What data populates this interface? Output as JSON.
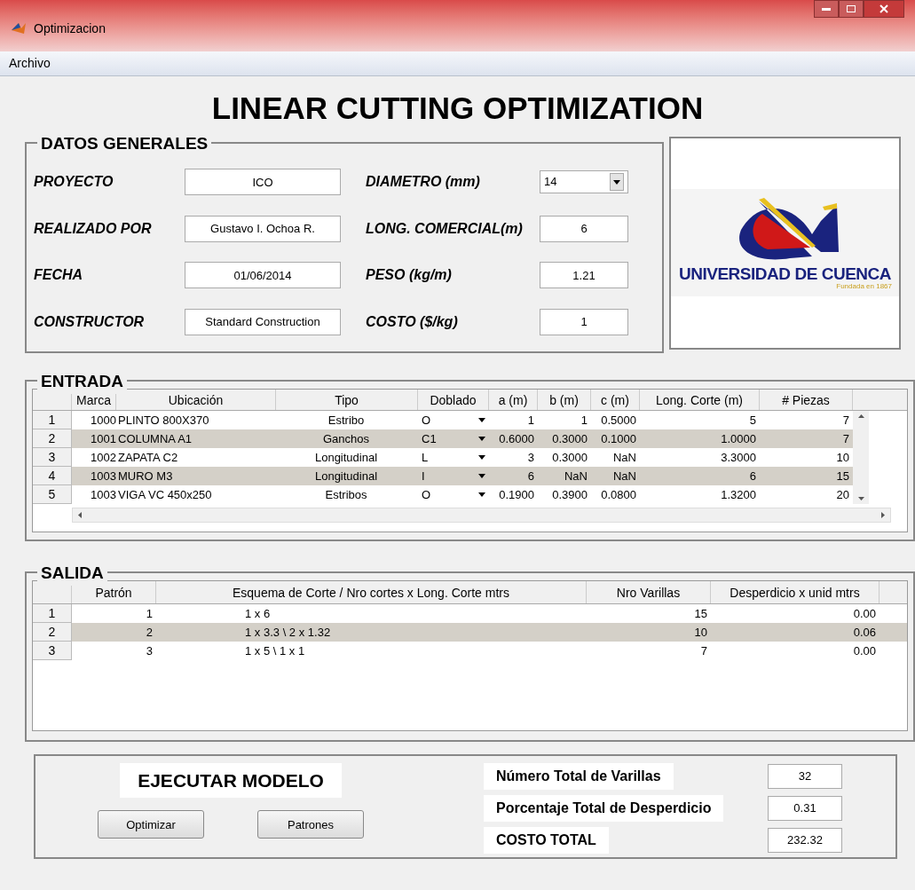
{
  "window": {
    "title": "Optimizacion"
  },
  "menu": [
    "Archivo"
  ],
  "heading": "LINEAR CUTTING OPTIMIZATION",
  "datos_generales": {
    "title": "DATOS GENERALES",
    "left": [
      {
        "label": "PROYECTO",
        "value": "ICO"
      },
      {
        "label": "REALIZADO POR",
        "value": "Gustavo I. Ochoa R."
      },
      {
        "label": "FECHA",
        "value": "01/06/2014"
      },
      {
        "label": "CONSTRUCTOR",
        "value": "Standard Construction"
      }
    ],
    "right": [
      {
        "label": "DIAMETRO (mm)",
        "value": "14",
        "kind": "dropdown"
      },
      {
        "label": "LONG. COMERCIAL(m)",
        "value": "6",
        "kind": "field"
      },
      {
        "label": "PESO (kg/m)",
        "value": "1.21",
        "kind": "field"
      },
      {
        "label": "COSTO ($/kg)",
        "value": "1",
        "kind": "field"
      }
    ]
  },
  "logo": {
    "name": "UNIVERSIDAD DE CUENCA",
    "tagline": "Fundada en 1867"
  },
  "entrada": {
    "title": "ENTRADA",
    "columns": [
      "Marca",
      "Ubicación",
      "Tipo",
      "Doblado",
      "a (m)",
      "b (m)",
      "c (m)",
      "Long. Corte (m)",
      "# Piezas"
    ],
    "rows": [
      {
        "index": "1",
        "cells": [
          "1000",
          "PLINTO 800X370",
          "Estribo",
          "O",
          "1",
          "1",
          "0.5000",
          "5",
          "7"
        ]
      },
      {
        "index": "2",
        "cells": [
          "1001",
          "COLUMNA A1",
          "Ganchos",
          "C1",
          "0.6000",
          "0.3000",
          "0.1000",
          "1.0000",
          "7"
        ]
      },
      {
        "index": "3",
        "cells": [
          "1002",
          "ZAPATA C2",
          "Longitudinal",
          "L",
          "3",
          "0.3000",
          "NaN",
          "3.3000",
          "10"
        ]
      },
      {
        "index": "4",
        "cells": [
          "1003",
          "MURO M3",
          "Longitudinal",
          "I",
          "6",
          "NaN",
          "NaN",
          "6",
          "15"
        ]
      },
      {
        "index": "5",
        "cells": [
          "1003",
          "VIGA VC 450x250",
          "Estribos",
          "O",
          "0.1900",
          "0.3900",
          "0.0800",
          "1.3200",
          "20"
        ]
      }
    ]
  },
  "salida": {
    "title": "SALIDA",
    "columns": [
      "Patrón",
      "Esquema de Corte /  Nro cortes x Long. Corte mtrs",
      "Nro Varillas",
      "Desperdicio x unid mtrs"
    ],
    "rows": [
      {
        "index": "1",
        "cells": [
          "1",
          "1 x 6",
          "15",
          "0.00"
        ]
      },
      {
        "index": "2",
        "cells": [
          "2",
          "1 x 3.3 \\ 2 x 1.32",
          "10",
          "0.06"
        ]
      },
      {
        "index": "3",
        "cells": [
          "3",
          "1 x 5 \\ 1 x 1",
          "7",
          "0.00"
        ]
      }
    ]
  },
  "ejecutar": {
    "title": "EJECUTAR MODELO",
    "buttons": [
      "Optimizar",
      "Patrones"
    ],
    "results": [
      {
        "label": "Número Total de Varillas",
        "value": "32"
      },
      {
        "label": "Porcentaje Total de Desperdicio",
        "value": "0.31"
      },
      {
        "label": "COSTO TOTAL",
        "value": "232.32"
      }
    ]
  }
}
